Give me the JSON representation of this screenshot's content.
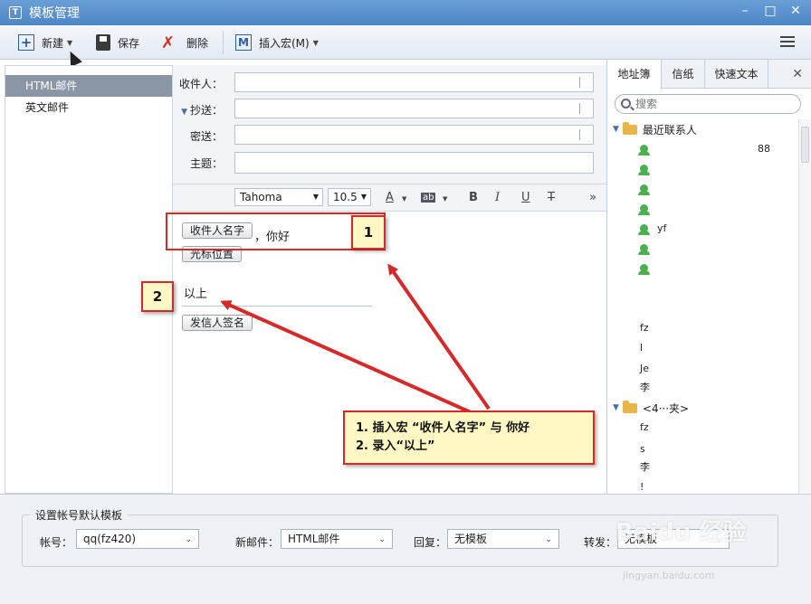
{
  "window": {
    "app_icon": "T",
    "title": "模板管理",
    "controls": [
      "–",
      "□",
      "✕"
    ]
  },
  "toolbar": {
    "new_label": "新建",
    "save_label": "保存",
    "delete_label": "删除",
    "insert_macro_label": "插入宏(M)",
    "m_icon_letter": "M"
  },
  "left_panel": {
    "items": [
      "HTML邮件",
      "英文邮件"
    ]
  },
  "form": {
    "to_label": "收件人：",
    "cc_label": "抄送：",
    "bcc_label": "密送：",
    "subject_label": "主题："
  },
  "format_bar": {
    "font": "Tahoma",
    "size": "10.5",
    "buttons": [
      "A",
      "ab",
      "B",
      "I",
      "U",
      "T",
      "»"
    ]
  },
  "editor": {
    "macro_recipient": "收件人名字",
    "greeting": "，你好",
    "macro_cursor": "光标位置",
    "closing": "以上",
    "macro_signature": "发信人签名"
  },
  "right_panel": {
    "tabs": [
      "地址簿",
      "信纸",
      "快速文本"
    ],
    "close": "✕",
    "search_placeholder": "搜索",
    "group_recent": "最近联系人",
    "contacts": [
      {
        "name": "",
        "num": "88"
      },
      {
        "name": "",
        "num": ""
      },
      {
        "name": "",
        "num": ""
      },
      {
        "name": "",
        "num": ""
      },
      {
        "name": "yf",
        "num": ""
      },
      {
        "name": "",
        "num": ""
      },
      {
        "name": "",
        "num": ""
      }
    ],
    "plain_contacts": [
      "fz",
      "l",
      "Je",
      "李"
    ],
    "group_2": "<4···夹>",
    "plain_contacts_2": [
      "fz",
      "s",
      "李",
      "!"
    ]
  },
  "bottom": {
    "group_title": "设置帐号默认模板",
    "account_label": "帐号：",
    "account_value": "qq(fz420)",
    "new_mail_label": "新邮件：",
    "new_mail_value": "HTML邮件",
    "reply_label": "回复：",
    "reply_value": "无模板",
    "forward_label": "转发：",
    "forward_value": "无模板"
  },
  "annotations": {
    "box1": "1",
    "box2": "2",
    "note_line1": "1. 插入宏 “收件人名字” 与 你好",
    "note_line2": "2. 录入“以上”",
    "color": "#d62a2a"
  },
  "watermark": {
    "main": "Baidu 经验",
    "sub": "jingyan.baidu.com"
  }
}
